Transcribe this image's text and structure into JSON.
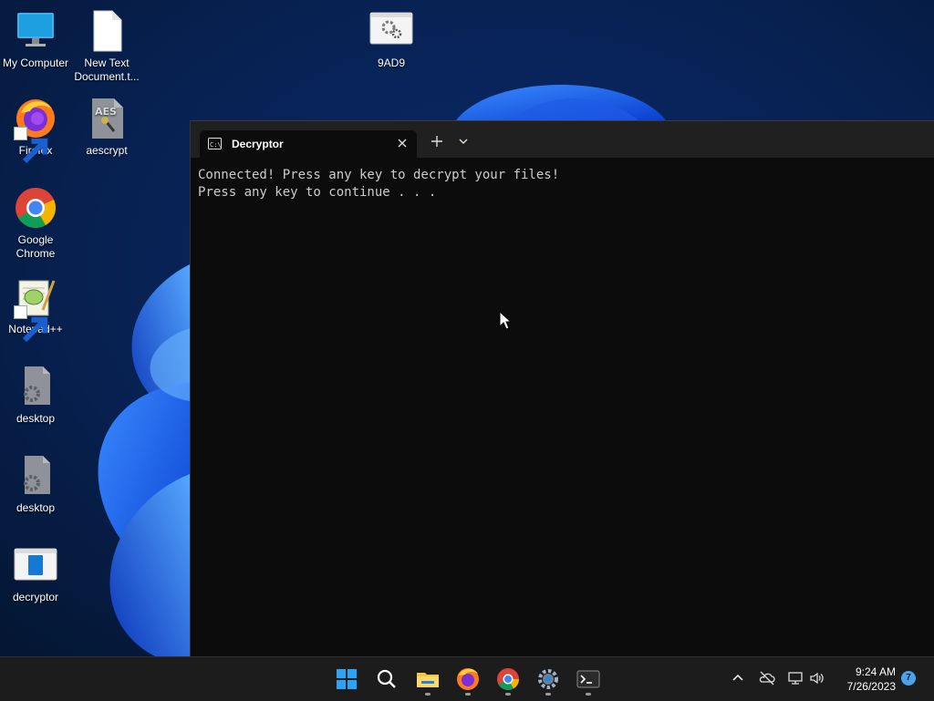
{
  "desktop": {
    "icons": [
      {
        "label": "My Computer"
      },
      {
        "label": "New Text Document.t..."
      },
      {
        "label": "9AD9"
      },
      {
        "label": "Firefox"
      },
      {
        "label": "aescrypt"
      },
      {
        "label": "Google Chrome"
      },
      {
        "label": "Notepad++"
      },
      {
        "label": "desktop"
      },
      {
        "label": "desktop"
      },
      {
        "label": "decryptor"
      }
    ]
  },
  "terminal": {
    "tab_title": "Decryptor",
    "new_tab_icon": "plus-icon",
    "dropdown_icon": "chevron-down-icon",
    "close_icon": "close-icon",
    "lines": [
      "Connected! Press any key to decrypt your files!",
      "Press any key to continue . . ."
    ]
  },
  "taskbar": {
    "apps": [
      "start-icon",
      "search-icon",
      "file-explorer-icon",
      "firefox-icon",
      "chrome-icon",
      "settings-icon",
      "terminal-icon"
    ],
    "tray": [
      "chevron-up-icon",
      "onedrive-icon",
      "network-icon",
      "volume-icon"
    ],
    "time": "9:24 AM",
    "date": "7/26/2023",
    "notification_count": "7"
  },
  "colors": {
    "terminal_bg": "#0c0c0c",
    "titlebar_bg": "#202020",
    "taskbar_bg": "#1c1c1c",
    "accent": "#1f6ff2"
  }
}
